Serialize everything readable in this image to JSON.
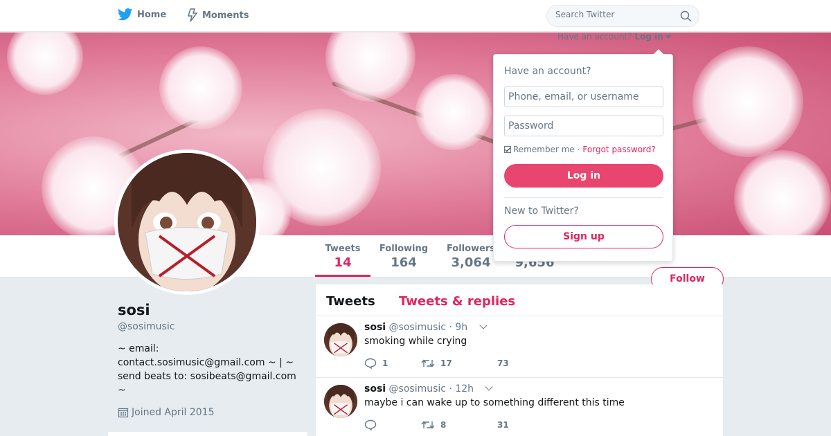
{
  "nav": {
    "home_label": "Home",
    "moments_label": "Moments",
    "search_placeholder": "Search Twitter"
  },
  "account_prompt": {
    "text": "Have an account?",
    "login_label": "Log in"
  },
  "login_dropdown": {
    "heading": "Have an account?",
    "username_placeholder": "Phone, email, or username",
    "password_placeholder": "Password",
    "remember_label": "Remember me",
    "separator": "·",
    "forgot_label": "Forgot password?",
    "login_button": "Log in",
    "new_prompt": "New to Twitter?",
    "signup_button": "Sign up"
  },
  "stats": {
    "tweets_label": "Tweets",
    "tweets_value": "14",
    "following_label": "Following",
    "following_value": "164",
    "followers_label": "Followers",
    "followers_value": "3,064",
    "likes_value": "9,656"
  },
  "follow_button": "Follow",
  "profile": {
    "name": "sosi",
    "handle": "@sosimusic",
    "bio": "~ email: contact.sosimusic@gmail.com ~ | ~ send beats to: sosibeats@gmail.com ~",
    "joined": "Joined April 2015"
  },
  "timeline": {
    "tab_tweets": "Tweets",
    "tab_replies": "Tweets & replies",
    "tweets": [
      {
        "name": "sosi",
        "handle": "@sosimusic",
        "time": "· 9h",
        "text": "smoking while crying",
        "replies": "1",
        "retweets": "17",
        "likes": "73"
      },
      {
        "name": "sosi",
        "handle": "@sosimusic",
        "time": "· 12h",
        "text": "maybe i can wake up to something different this time",
        "replies": "",
        "retweets": "8",
        "likes": "31"
      }
    ]
  },
  "colors": {
    "accent": "#e0245e",
    "link": "#e0245e",
    "muted": "#657786"
  }
}
